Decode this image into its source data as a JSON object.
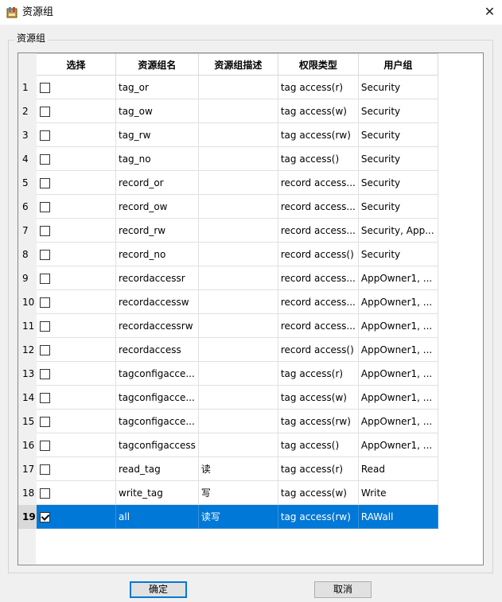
{
  "window": {
    "title": "资源组",
    "close_glyph": "✕"
  },
  "group": {
    "label": "资源组"
  },
  "columns": [
    "选择",
    "资源组名",
    "资源组描述",
    "权限类型",
    "用户组"
  ],
  "rows": [
    {
      "num": "1",
      "checked": false,
      "name": "tag_or",
      "desc": "",
      "perm": "tag access(r)",
      "user": "Security"
    },
    {
      "num": "2",
      "checked": false,
      "name": "tag_ow",
      "desc": "",
      "perm": "tag access(w)",
      "user": "Security"
    },
    {
      "num": "3",
      "checked": false,
      "name": "tag_rw",
      "desc": "",
      "perm": "tag access(rw)",
      "user": "Security"
    },
    {
      "num": "4",
      "checked": false,
      "name": "tag_no",
      "desc": "",
      "perm": "tag access()",
      "user": "Security"
    },
    {
      "num": "5",
      "checked": false,
      "name": "record_or",
      "desc": "",
      "perm": "record access...",
      "user": "Security"
    },
    {
      "num": "6",
      "checked": false,
      "name": "record_ow",
      "desc": "",
      "perm": "record access...",
      "user": "Security"
    },
    {
      "num": "7",
      "checked": false,
      "name": "record_rw",
      "desc": "",
      "perm": "record access...",
      "user": "Security, App..."
    },
    {
      "num": "8",
      "checked": false,
      "name": "record_no",
      "desc": "",
      "perm": "record access()",
      "user": "Security"
    },
    {
      "num": "9",
      "checked": false,
      "name": "recordaccessr",
      "desc": "",
      "perm": "record access...",
      "user": "AppOwner1, ..."
    },
    {
      "num": "10",
      "checked": false,
      "name": "recordaccessw",
      "desc": "",
      "perm": "record access...",
      "user": "AppOwner1, ..."
    },
    {
      "num": "11",
      "checked": false,
      "name": "recordaccessrw",
      "desc": "",
      "perm": "record access...",
      "user": "AppOwner1, ..."
    },
    {
      "num": "12",
      "checked": false,
      "name": "recordaccess",
      "desc": "",
      "perm": "record access()",
      "user": "AppOwner1, ..."
    },
    {
      "num": "13",
      "checked": false,
      "name": "tagconfigacce...",
      "desc": "",
      "perm": "tag access(r)",
      "user": "AppOwner1, ..."
    },
    {
      "num": "14",
      "checked": false,
      "name": "tagconfigacce...",
      "desc": "",
      "perm": "tag access(w)",
      "user": "AppOwner1, ..."
    },
    {
      "num": "15",
      "checked": false,
      "name": "tagconfigacce...",
      "desc": "",
      "perm": "tag access(rw)",
      "user": "AppOwner1, ..."
    },
    {
      "num": "16",
      "checked": false,
      "name": "tagconfigaccess",
      "desc": "",
      "perm": "tag access()",
      "user": "AppOwner1, ..."
    },
    {
      "num": "17",
      "checked": false,
      "name": "read_tag",
      "desc": "读",
      "perm": "tag access(r)",
      "user": "Read"
    },
    {
      "num": "18",
      "checked": false,
      "name": "write_tag",
      "desc": "写",
      "perm": "tag access(w)",
      "user": "Write"
    },
    {
      "num": "19",
      "checked": true,
      "name": "all",
      "desc": "读写",
      "perm": "tag access(rw)",
      "user": "RAWall",
      "selected": true
    }
  ],
  "buttons": {
    "ok": "确定",
    "cancel": "取消"
  },
  "colors": {
    "selection": "#0078d7",
    "default_button_border": "#0078d7"
  }
}
